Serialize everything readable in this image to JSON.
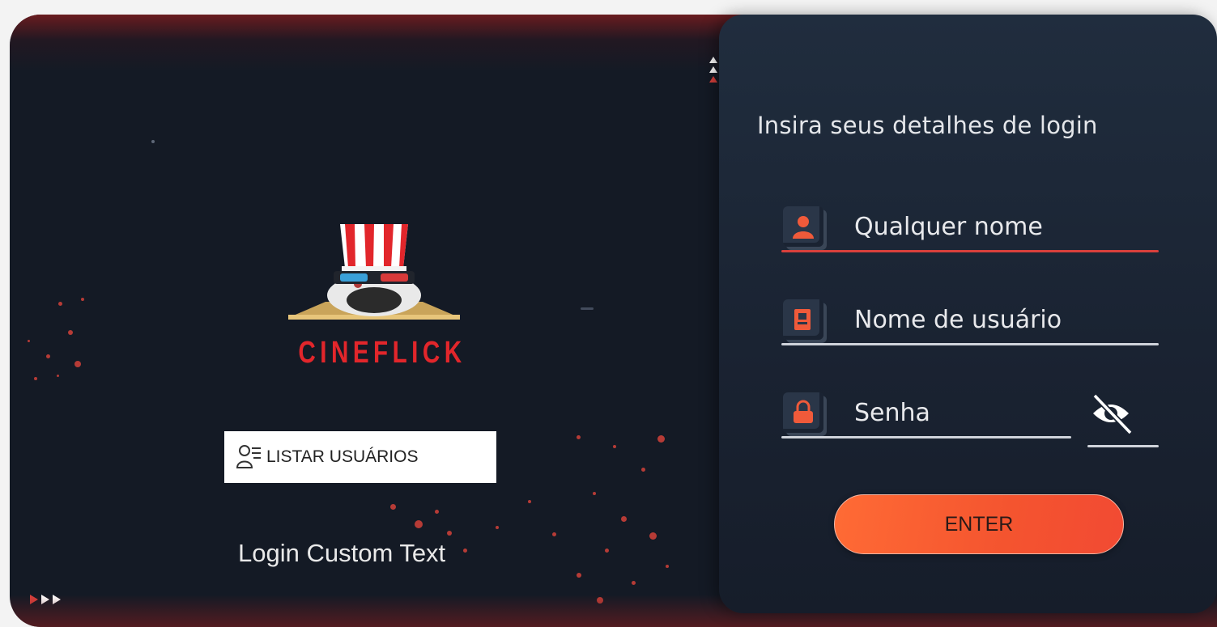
{
  "brand": {
    "name": "CINEFLICK"
  },
  "left": {
    "list_users_button": "LISTAR USUÁRIOS",
    "custom_text": "Login Custom Text"
  },
  "login": {
    "heading": "Insira seus detalhes de login",
    "name_placeholder": "Qualquer nome",
    "username_placeholder": "Nome de usuário",
    "password_placeholder": "Senha",
    "enter_button": "ENTER"
  },
  "icons": {
    "name_field": "user-icon",
    "username_field": "id-card-icon",
    "password_field": "lock-icon",
    "password_toggle": "eye-slash-icon",
    "list_users": "users-list-icon",
    "logo": "popcorn-mascot-icon"
  },
  "colors": {
    "accent": "#e2262b",
    "button_gradient_start": "#ff6b35",
    "button_gradient_end": "#f24a33",
    "background": "#141a25",
    "panel": "#1d2838"
  }
}
